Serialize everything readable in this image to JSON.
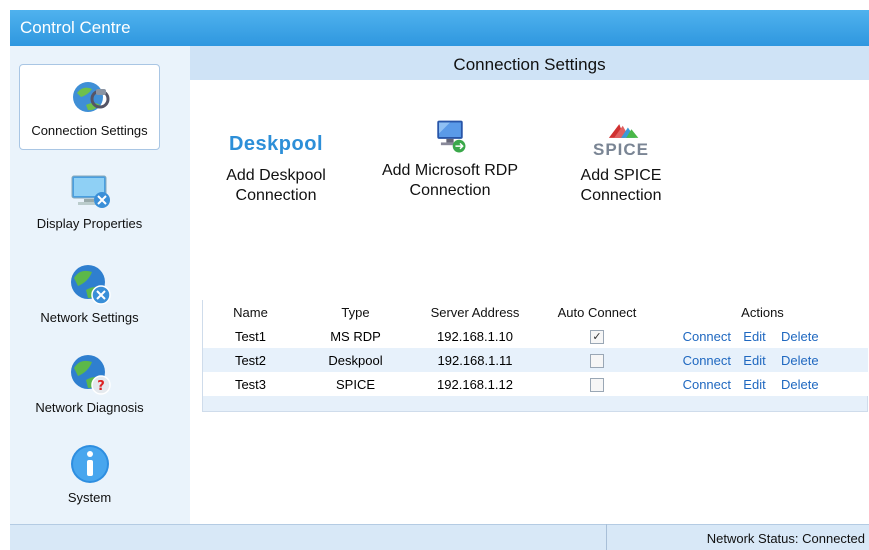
{
  "window": {
    "title": "Control Centre"
  },
  "sidebar": {
    "items": [
      {
        "label": "Connection Settings",
        "icon": "connection-settings-icon",
        "active": true
      },
      {
        "label": "Display Properties",
        "icon": "display-properties-icon",
        "active": false
      },
      {
        "label": "Network Settings",
        "icon": "network-settings-icon",
        "active": false
      },
      {
        "label": "Network Diagnosis",
        "icon": "network-diagnosis-icon",
        "active": false
      },
      {
        "label": "System",
        "icon": "info-icon",
        "active": false
      }
    ]
  },
  "main": {
    "title": "Connection Settings",
    "add_buttons": [
      {
        "logo_text": "Deskpool",
        "line1": "Add Deskpool",
        "line2": "Connection"
      },
      {
        "logo_text": "",
        "line1": "Add Microsoft RDP",
        "line2": "Connection"
      },
      {
        "logo_text": "SPICE",
        "line1": "Add SPICE",
        "line2": "Connection"
      }
    ],
    "table": {
      "headers": [
        "Name",
        "Type",
        "Server Address",
        "Auto Connect",
        "Actions"
      ],
      "rows": [
        {
          "name": "Test1",
          "type": "MS RDP",
          "server": "192.168.1.10",
          "auto_connect": true,
          "check_mark": "✓"
        },
        {
          "name": "Test2",
          "type": "Deskpool",
          "server": "192.168.1.11",
          "auto_connect": false,
          "check_mark": ""
        },
        {
          "name": "Test3",
          "type": "SPICE",
          "server": "192.168.1.12",
          "auto_connect": false,
          "check_mark": ""
        }
      ],
      "actions": {
        "connect": "Connect",
        "edit": "Edit",
        "delete": "Delete"
      }
    }
  },
  "status": {
    "text": "Network Status: Connected"
  },
  "colors": {
    "titlebar": "#3ba4e6",
    "link": "#1f68c0",
    "header_bg": "#cfe3f6",
    "sidebar_bg": "#eaf3fb"
  }
}
